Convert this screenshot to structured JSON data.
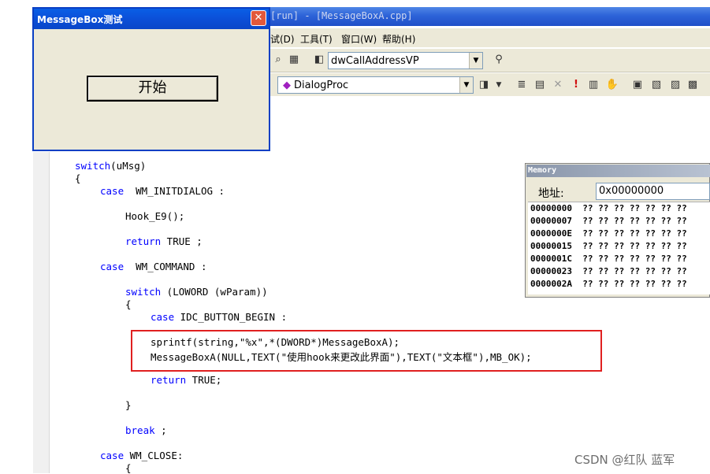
{
  "ide": {
    "title": "[run] - [MessageBoxA.cpp]",
    "menu": [
      "试(D)",
      "工具(T)",
      "窗口(W)",
      "帮助(H)"
    ],
    "toolbar1": {
      "combo_value": "dwCallAddressVP"
    },
    "toolbar2": {
      "combo_value": "DialogProc"
    }
  },
  "code": {
    "lines": [
      {
        "kw": "switch",
        "rest": "(uMsg)"
      },
      {
        "kw": "",
        "rest": "{"
      },
      {
        "kw": "case",
        "rest": "  WM_INITDIALOG :"
      },
      {
        "kw": "",
        "rest": "Hook_E9();"
      },
      {
        "kw": "return",
        "rest": " TRUE ;"
      },
      {
        "kw": "case",
        "rest": "  WM_COMMAND :"
      },
      {
        "kw": "switch",
        "rest": " (LOWORD (wParam))"
      },
      {
        "kw": "",
        "rest": "{"
      },
      {
        "kw": "case",
        "rest": " IDC_BUTTON_BEGIN :"
      },
      {
        "kw": "",
        "rest": "sprintf(string,\"%x\",*(DWORD*)MessageBoxA);"
      },
      {
        "kw": "",
        "rest": "MessageBoxA(NULL,TEXT(\"使用hook来更改此界面\"),TEXT(\"文本框\"),MB_OK);"
      },
      {
        "kw": "return",
        "rest": " TRUE;"
      },
      {
        "kw": "",
        "rest": "}"
      },
      {
        "kw": "break",
        "rest": " ;"
      },
      {
        "kw": "case",
        "rest": " WM_CLOSE:"
      },
      {
        "kw": "",
        "rest": "{"
      }
    ]
  },
  "dialog": {
    "title": "MessageBox测试",
    "close_glyph": "✕",
    "start_button": "开始"
  },
  "memory": {
    "title": "Memory",
    "address_label": "地址:",
    "address_value": "0x00000000",
    "rows": [
      {
        "addr": "00000000",
        "bytes": "?? ?? ?? ?? ?? ?? ??"
      },
      {
        "addr": "00000007",
        "bytes": "?? ?? ?? ?? ?? ?? ??"
      },
      {
        "addr": "0000000E",
        "bytes": "?? ?? ?? ?? ?? ?? ??"
      },
      {
        "addr": "00000015",
        "bytes": "?? ?? ?? ?? ?? ?? ??"
      },
      {
        "addr": "0000001C",
        "bytes": "?? ?? ?? ?? ?? ?? ??"
      },
      {
        "addr": "00000023",
        "bytes": "?? ?? ?? ?? ?? ?? ??"
      },
      {
        "addr": "0000002A",
        "bytes": "?? ?? ?? ?? ?? ?? ??"
      }
    ]
  },
  "watermark": "CSDN @红队 蓝军",
  "icons": [
    "dropdown-arrow-icon",
    "build-icon",
    "stop-icon",
    "breakpoint-icon",
    "hand-icon",
    "class-icon",
    "function-icon"
  ]
}
